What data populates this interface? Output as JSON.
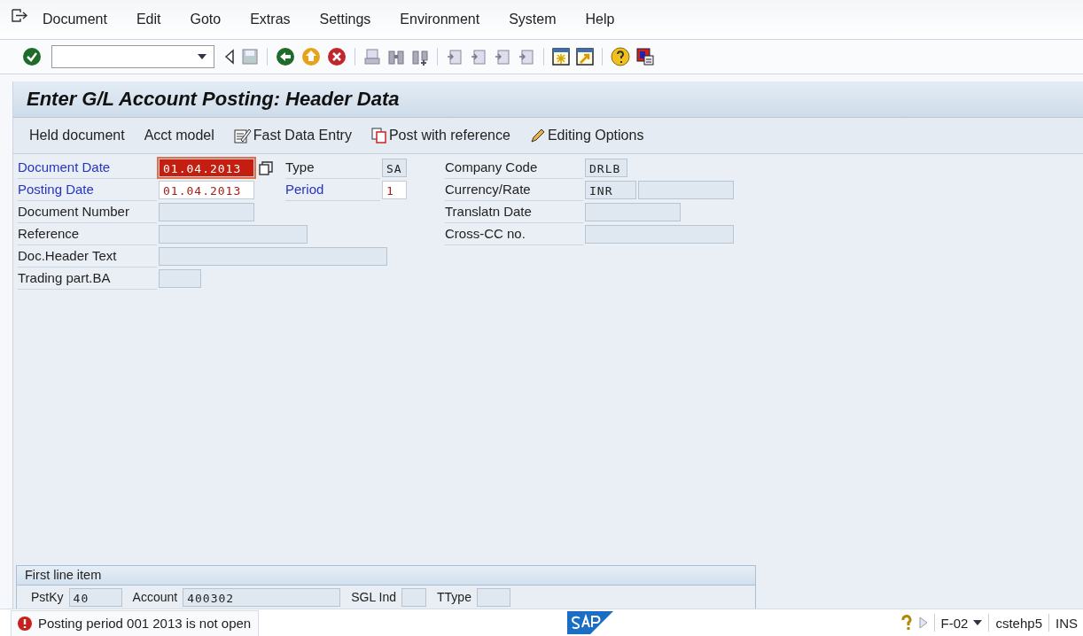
{
  "menu": [
    "Document",
    "Edit",
    "Goto",
    "Extras",
    "Settings",
    "Environment",
    "System",
    "Help"
  ],
  "title": "Enter G/L Account Posting: Header Data",
  "app_toolbar": [
    {
      "label": "Held document",
      "kind": "text"
    },
    {
      "label": "Acct model",
      "kind": "text"
    },
    {
      "label": "Fast Data Entry",
      "kind": "fast"
    },
    {
      "label": "Post with reference",
      "kind": "copy"
    },
    {
      "label": "Editing Options",
      "kind": "pencil"
    }
  ],
  "columns": [
    [
      {
        "label": "Document Date",
        "required": true,
        "value_help": true,
        "inputs": [
          {
            "value": "01.04.2013",
            "editable": true,
            "selected": true
          }
        ]
      },
      {
        "label": "Posting Date",
        "required": true,
        "inputs": [
          {
            "value": "01.04.2013",
            "editable": true,
            "selected": false
          }
        ]
      },
      {
        "label": "Document Number",
        "required": false,
        "inputs": [
          {
            "editable": false,
            "selected": false
          }
        ]
      },
      {
        "label": "Reference",
        "required": false,
        "inputs": [
          {
            "editable": false,
            "selected": false
          }
        ]
      },
      {
        "label": "Doc.Header Text",
        "required": false,
        "inputs": [
          {
            "editable": false,
            "selected": false
          }
        ]
      },
      {
        "label": "Trading part.BA",
        "required": false,
        "inputs": [
          {
            "editable": false,
            "selected": false
          }
        ]
      }
    ],
    [
      {
        "label": "Type",
        "required": false,
        "inputs": [
          {
            "value": "SA",
            "editable": false,
            "selected": false
          }
        ]
      },
      {
        "label": "Period",
        "required": true,
        "inputs": [
          {
            "value": "1",
            "editable": true,
            "selected": false
          }
        ]
      }
    ],
    [
      {
        "label": "Company Code",
        "required": false,
        "inputs": [
          {
            "value": "DRLB",
            "editable": false,
            "selected": false
          }
        ]
      },
      {
        "label": "Currency/Rate",
        "required": false,
        "inputs": [
          {
            "value": "INR",
            "editable": false,
            "selected": false
          },
          {
            "editable": false,
            "selected": false
          }
        ]
      },
      {
        "label": "Translatn Date",
        "required": false,
        "inputs": [
          {
            "editable": false,
            "selected": false
          }
        ]
      },
      {
        "label": "Cross-CC no.",
        "required": false,
        "inputs": [
          {
            "editable": false,
            "selected": false
          }
        ]
      }
    ]
  ],
  "first_line_item": {
    "title": "First line item",
    "fields": [
      {
        "label": "PstKy",
        "value": "40"
      },
      {
        "label": "Account",
        "value": "400302"
      },
      {
        "label": "SGL Ind"
      },
      {
        "label": "TType"
      }
    ]
  },
  "status_bar": {
    "message": {
      "kind": "error",
      "text": "Posting period 001 2013 is not open"
    },
    "transaction": "F-02",
    "server": "cstehp5",
    "mode": "INS"
  }
}
